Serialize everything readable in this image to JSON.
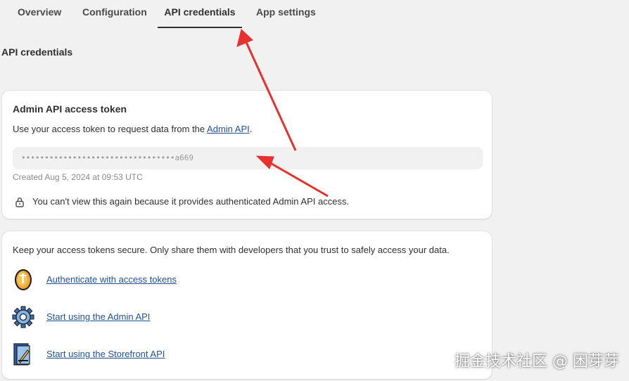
{
  "tabs": [
    {
      "label": "Overview",
      "active": false
    },
    {
      "label": "Configuration",
      "active": false
    },
    {
      "label": "API credentials",
      "active": true
    },
    {
      "label": "App settings",
      "active": false
    }
  ],
  "page_title": "API credentials",
  "admin_token_card": {
    "title": "Admin API access token",
    "description_prefix": "Use your access token to request data from the ",
    "description_link": "Admin API",
    "description_suffix": ".",
    "token_masked": "•••••••••••••••••••••••••••••••••a669",
    "created": "Created Aug 5, 2024 at 09:53 UTC",
    "lock_notice": "You can't view this again because it provides authenticated Admin API access.",
    "lock_icon": "lock-icon"
  },
  "resources_card": {
    "intro": "Keep your access tokens secure. Only share them with developers that you trust to safely access your data.",
    "items": [
      {
        "label": "Authenticate with access tokens",
        "icon": "coin-icon"
      },
      {
        "label": "Start using the Admin API",
        "icon": "gear-icon"
      },
      {
        "label": "Start using the Storefront API",
        "icon": "storefront-icon"
      }
    ]
  },
  "watermark": "掘金技术社区 @ 困芽芽",
  "colors": {
    "background": "#f1f1f1",
    "link": "#1f5199",
    "annotation_arrow": "#e8302f",
    "active_tab_underline": "#303030"
  }
}
